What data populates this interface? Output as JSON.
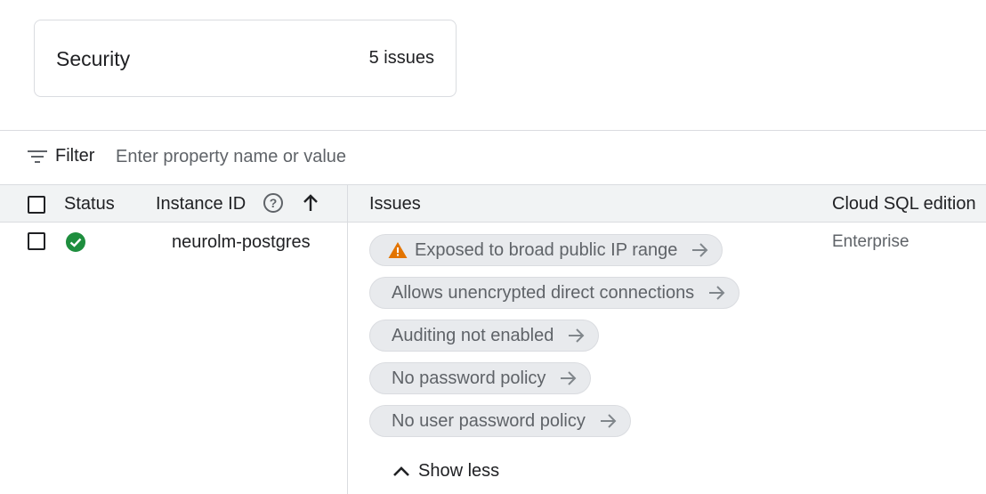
{
  "summary": {
    "title": "Security",
    "count": "5 issues"
  },
  "filter": {
    "label": "Filter",
    "placeholder": "Enter property name or value"
  },
  "table": {
    "columns": {
      "status": "Status",
      "instance_id": "Instance ID",
      "issues": "Issues",
      "edition": "Cloud SQL edition"
    },
    "rows": [
      {
        "status": "ok",
        "instance_id": "neurolm-postgres",
        "edition": "Enterprise",
        "issues": [
          "Exposed to broad public IP range",
          "Allows unencrypted direct connections",
          "Auditing not enabled",
          "No password policy",
          "No user password policy"
        ]
      }
    ],
    "toggle_label": "Show less"
  },
  "colors": {
    "ok_green": "#1e8e3e",
    "warning_orange": "#e37400",
    "chip_bg": "#e8eaed"
  },
  "icons": [
    "filter-icon",
    "help-icon",
    "arrow-up-icon",
    "check-circle-icon",
    "warning-icon",
    "arrow-right-icon",
    "chevron-up-icon"
  ]
}
